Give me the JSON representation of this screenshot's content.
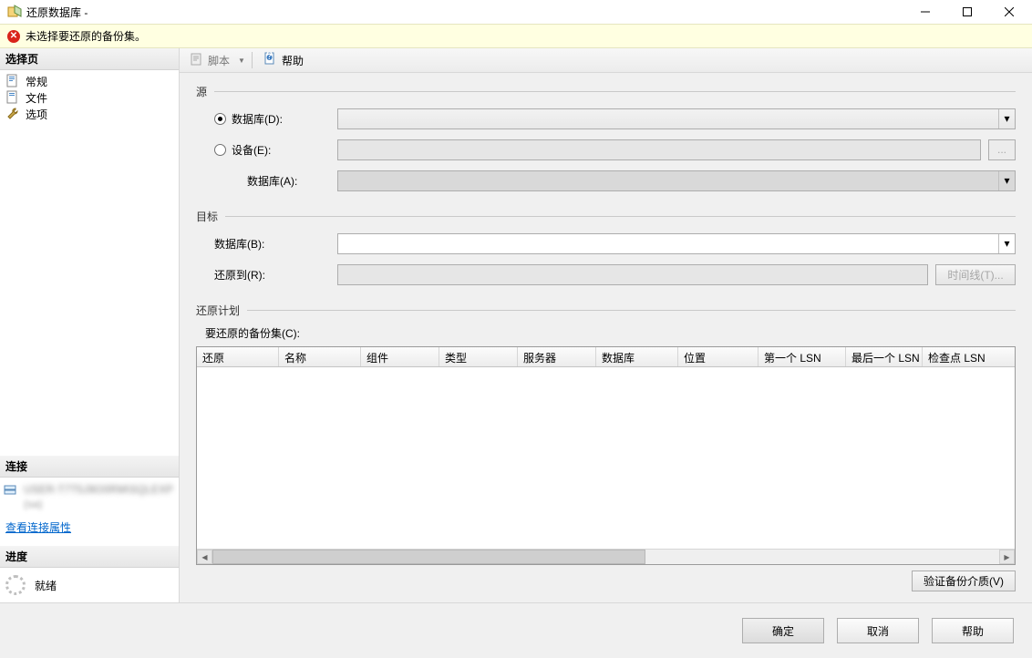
{
  "window": {
    "title": "还原数据库 -"
  },
  "warning": {
    "text": "未选择要还原的备份集。"
  },
  "left_panel": {
    "select_page_header": "选择页",
    "nav": {
      "general": "常规",
      "files": "文件",
      "options": "选项"
    },
    "connection_header": "连接",
    "connection_server_blur": "USER-T7T5J9O0RM\\SQLEXP",
    "connection_user_blur": "(sa)",
    "view_props_link": "查看连接属性",
    "progress_header": "进度",
    "progress_status": "就绪"
  },
  "toolbar": {
    "script": "脚本",
    "help": "帮助"
  },
  "groups": {
    "source": {
      "legend": "源",
      "radio_db": "数据库(D):",
      "radio_device": "设备(E):",
      "sub_db": "数据库(A):",
      "ellipsis": "..."
    },
    "target": {
      "legend": "目标",
      "db": "数据库(B):",
      "restore_to": "还原到(R):",
      "timeline_btn": "时间线(T)..."
    },
    "plan": {
      "legend": "还原计划",
      "sets_label": "要还原的备份集(C):",
      "columns": [
        "还原",
        "名称",
        "组件",
        "类型",
        "服务器",
        "数据库",
        "位置",
        "第一个 LSN",
        "最后一个 LSN",
        "检查点 LSN"
      ],
      "verify_btn": "验证备份介质(V)"
    }
  },
  "footer": {
    "ok": "确定",
    "cancel": "取消",
    "help": "帮助"
  }
}
